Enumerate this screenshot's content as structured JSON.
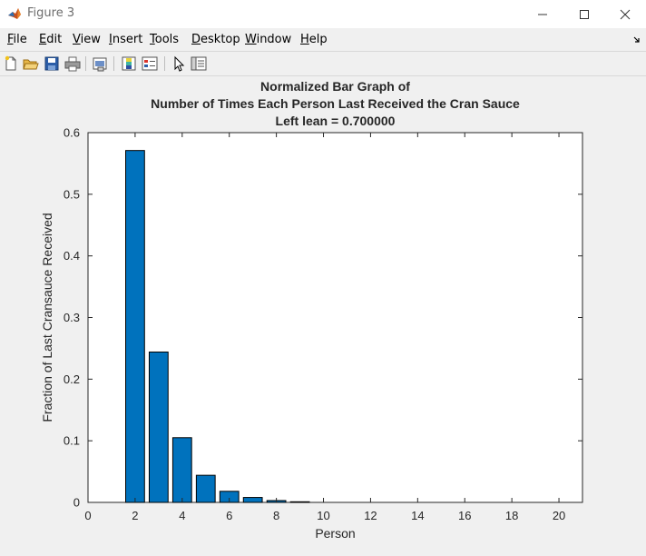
{
  "window": {
    "title": "Figure 3"
  },
  "menu": [
    {
      "pre": "",
      "ul": "F",
      "post": "ile"
    },
    {
      "pre": "",
      "ul": "E",
      "post": "dit"
    },
    {
      "pre": "",
      "ul": "V",
      "post": "iew"
    },
    {
      "pre": "",
      "ul": "I",
      "post": "nsert"
    },
    {
      "pre": "",
      "ul": "T",
      "post": "ools"
    },
    {
      "pre": "",
      "ul": "D",
      "post": "esktop"
    },
    {
      "pre": "",
      "ul": "W",
      "post": "indow"
    },
    {
      "pre": "",
      "ul": "H",
      "post": "elp"
    }
  ],
  "toolbar_icons": [
    "new-figure-icon",
    "open-file-icon",
    "save-icon",
    "print-icon",
    "link-plot-icon",
    "insert-colorbar-icon",
    "insert-legend-icon",
    "edit-plot-icon",
    "property-inspector-icon"
  ],
  "colors": {
    "bar": "#0072bd",
    "bar_edge": "#000000",
    "axes_bg": "#ffffff",
    "figure_bg": "#f0f0f0"
  },
  "chart_data": {
    "type": "bar",
    "title": [
      "Normalized Bar Graph of",
      "Number of Times Each Person Last Received the Cran Sauce",
      "Left lean = 0.700000"
    ],
    "xlabel": "Person",
    "ylabel": "Fraction of Last Cransauce Received",
    "xlim": [
      0,
      21
    ],
    "ylim": [
      0,
      0.6
    ],
    "xticks": [
      0,
      2,
      4,
      6,
      8,
      10,
      12,
      14,
      16,
      18,
      20
    ],
    "yticks": [
      0,
      0.1,
      0.2,
      0.3,
      0.4,
      0.5,
      0.6
    ],
    "x": [
      2,
      3,
      4,
      5,
      6,
      7,
      8,
      9,
      10,
      11,
      12,
      13,
      14,
      15,
      16,
      17,
      18,
      19,
      20
    ],
    "values": [
      0.571,
      0.244,
      0.105,
      0.044,
      0.018,
      0.008,
      0.003,
      0.001,
      0,
      0,
      0,
      0,
      0,
      0,
      0,
      0,
      0,
      0,
      0
    ],
    "grid": false
  }
}
